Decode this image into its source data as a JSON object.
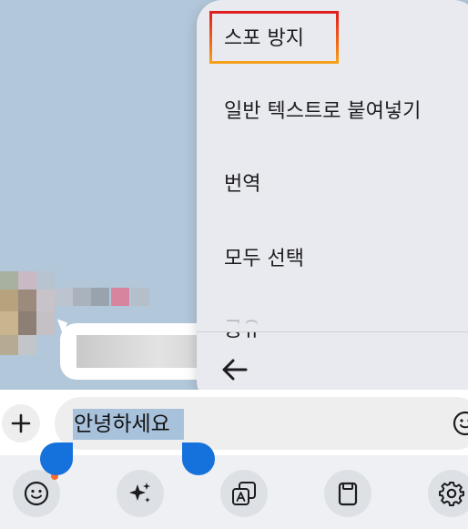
{
  "context_menu": {
    "items": [
      {
        "label": "스포 방지"
      },
      {
        "label": "일반 텍스트로 붙여넣기"
      },
      {
        "label": "번역"
      },
      {
        "label": "모두 선택"
      },
      {
        "label": "공유"
      }
    ],
    "back_icon": "arrow-left-icon",
    "highlight_color_top": "#e02020",
    "highlight_color_bottom": "#f5a01a"
  },
  "input": {
    "text": "안녕하세요",
    "selection_color": "#a9c2dc",
    "handle_color": "#1572dc"
  },
  "toolbar": {
    "items": [
      {
        "icon": "emoji-icon"
      },
      {
        "icon": "sparkle-icon"
      },
      {
        "icon": "translate-icon"
      },
      {
        "icon": "clipboard-icon"
      },
      {
        "icon": "gear-icon"
      }
    ]
  },
  "colors": {
    "chat_background": "#b2c7da",
    "menu_background": "#e9eaef"
  }
}
